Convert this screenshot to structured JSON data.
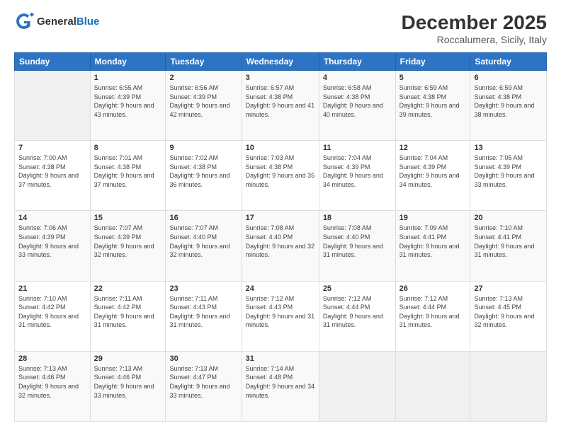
{
  "logo": {
    "general": "General",
    "blue": "Blue"
  },
  "header": {
    "month": "December 2025",
    "location": "Roccalumera, Sicily, Italy"
  },
  "weekdays": [
    "Sunday",
    "Monday",
    "Tuesday",
    "Wednesday",
    "Thursday",
    "Friday",
    "Saturday"
  ],
  "weeks": [
    [
      {
        "day": "",
        "sunrise": "",
        "sunset": "",
        "daylight": ""
      },
      {
        "day": "1",
        "sunrise": "Sunrise: 6:55 AM",
        "sunset": "Sunset: 4:39 PM",
        "daylight": "Daylight: 9 hours and 43 minutes."
      },
      {
        "day": "2",
        "sunrise": "Sunrise: 6:56 AM",
        "sunset": "Sunset: 4:39 PM",
        "daylight": "Daylight: 9 hours and 42 minutes."
      },
      {
        "day": "3",
        "sunrise": "Sunrise: 6:57 AM",
        "sunset": "Sunset: 4:38 PM",
        "daylight": "Daylight: 9 hours and 41 minutes."
      },
      {
        "day": "4",
        "sunrise": "Sunrise: 6:58 AM",
        "sunset": "Sunset: 4:38 PM",
        "daylight": "Daylight: 9 hours and 40 minutes."
      },
      {
        "day": "5",
        "sunrise": "Sunrise: 6:59 AM",
        "sunset": "Sunset: 4:38 PM",
        "daylight": "Daylight: 9 hours and 39 minutes."
      },
      {
        "day": "6",
        "sunrise": "Sunrise: 6:59 AM",
        "sunset": "Sunset: 4:38 PM",
        "daylight": "Daylight: 9 hours and 38 minutes."
      }
    ],
    [
      {
        "day": "7",
        "sunrise": "Sunrise: 7:00 AM",
        "sunset": "Sunset: 4:38 PM",
        "daylight": "Daylight: 9 hours and 37 minutes."
      },
      {
        "day": "8",
        "sunrise": "Sunrise: 7:01 AM",
        "sunset": "Sunset: 4:38 PM",
        "daylight": "Daylight: 9 hours and 37 minutes."
      },
      {
        "day": "9",
        "sunrise": "Sunrise: 7:02 AM",
        "sunset": "Sunset: 4:38 PM",
        "daylight": "Daylight: 9 hours and 36 minutes."
      },
      {
        "day": "10",
        "sunrise": "Sunrise: 7:03 AM",
        "sunset": "Sunset: 4:38 PM",
        "daylight": "Daylight: 9 hours and 35 minutes."
      },
      {
        "day": "11",
        "sunrise": "Sunrise: 7:04 AM",
        "sunset": "Sunset: 4:39 PM",
        "daylight": "Daylight: 9 hours and 34 minutes."
      },
      {
        "day": "12",
        "sunrise": "Sunrise: 7:04 AM",
        "sunset": "Sunset: 4:39 PM",
        "daylight": "Daylight: 9 hours and 34 minutes."
      },
      {
        "day": "13",
        "sunrise": "Sunrise: 7:05 AM",
        "sunset": "Sunset: 4:39 PM",
        "daylight": "Daylight: 9 hours and 33 minutes."
      }
    ],
    [
      {
        "day": "14",
        "sunrise": "Sunrise: 7:06 AM",
        "sunset": "Sunset: 4:39 PM",
        "daylight": "Daylight: 9 hours and 33 minutes."
      },
      {
        "day": "15",
        "sunrise": "Sunrise: 7:07 AM",
        "sunset": "Sunset: 4:39 PM",
        "daylight": "Daylight: 9 hours and 32 minutes."
      },
      {
        "day": "16",
        "sunrise": "Sunrise: 7:07 AM",
        "sunset": "Sunset: 4:40 PM",
        "daylight": "Daylight: 9 hours and 32 minutes."
      },
      {
        "day": "17",
        "sunrise": "Sunrise: 7:08 AM",
        "sunset": "Sunset: 4:40 PM",
        "daylight": "Daylight: 9 hours and 32 minutes."
      },
      {
        "day": "18",
        "sunrise": "Sunrise: 7:08 AM",
        "sunset": "Sunset: 4:40 PM",
        "daylight": "Daylight: 9 hours and 31 minutes."
      },
      {
        "day": "19",
        "sunrise": "Sunrise: 7:09 AM",
        "sunset": "Sunset: 4:41 PM",
        "daylight": "Daylight: 9 hours and 31 minutes."
      },
      {
        "day": "20",
        "sunrise": "Sunrise: 7:10 AM",
        "sunset": "Sunset: 4:41 PM",
        "daylight": "Daylight: 9 hours and 31 minutes."
      }
    ],
    [
      {
        "day": "21",
        "sunrise": "Sunrise: 7:10 AM",
        "sunset": "Sunset: 4:42 PM",
        "daylight": "Daylight: 9 hours and 31 minutes."
      },
      {
        "day": "22",
        "sunrise": "Sunrise: 7:11 AM",
        "sunset": "Sunset: 4:42 PM",
        "daylight": "Daylight: 9 hours and 31 minutes."
      },
      {
        "day": "23",
        "sunrise": "Sunrise: 7:11 AM",
        "sunset": "Sunset: 4:43 PM",
        "daylight": "Daylight: 9 hours and 31 minutes."
      },
      {
        "day": "24",
        "sunrise": "Sunrise: 7:12 AM",
        "sunset": "Sunset: 4:43 PM",
        "daylight": "Daylight: 9 hours and 31 minutes."
      },
      {
        "day": "25",
        "sunrise": "Sunrise: 7:12 AM",
        "sunset": "Sunset: 4:44 PM",
        "daylight": "Daylight: 9 hours and 31 minutes."
      },
      {
        "day": "26",
        "sunrise": "Sunrise: 7:12 AM",
        "sunset": "Sunset: 4:44 PM",
        "daylight": "Daylight: 9 hours and 31 minutes."
      },
      {
        "day": "27",
        "sunrise": "Sunrise: 7:13 AM",
        "sunset": "Sunset: 4:45 PM",
        "daylight": "Daylight: 9 hours and 32 minutes."
      }
    ],
    [
      {
        "day": "28",
        "sunrise": "Sunrise: 7:13 AM",
        "sunset": "Sunset: 4:46 PM",
        "daylight": "Daylight: 9 hours and 32 minutes."
      },
      {
        "day": "29",
        "sunrise": "Sunrise: 7:13 AM",
        "sunset": "Sunset: 4:46 PM",
        "daylight": "Daylight: 9 hours and 33 minutes."
      },
      {
        "day": "30",
        "sunrise": "Sunrise: 7:13 AM",
        "sunset": "Sunset: 4:47 PM",
        "daylight": "Daylight: 9 hours and 33 minutes."
      },
      {
        "day": "31",
        "sunrise": "Sunrise: 7:14 AM",
        "sunset": "Sunset: 4:48 PM",
        "daylight": "Daylight: 9 hours and 34 minutes."
      },
      {
        "day": "",
        "sunrise": "",
        "sunset": "",
        "daylight": ""
      },
      {
        "day": "",
        "sunrise": "",
        "sunset": "",
        "daylight": ""
      },
      {
        "day": "",
        "sunrise": "",
        "sunset": "",
        "daylight": ""
      }
    ]
  ]
}
